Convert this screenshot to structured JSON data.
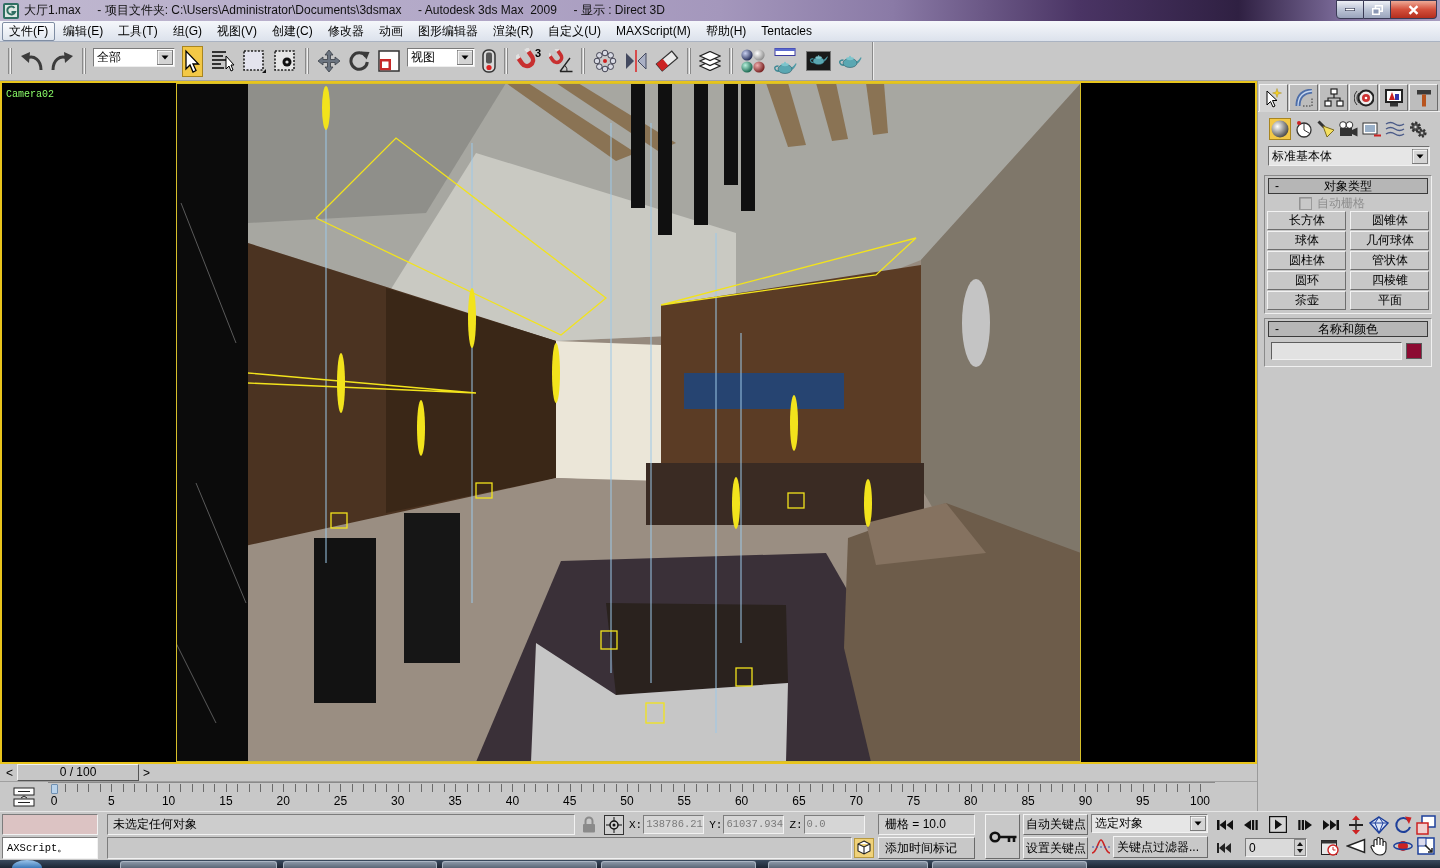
{
  "window": {
    "title": "大厅1.max     - 项目文件夹: C:\\Users\\Administrator\\Documents\\3dsmax     - Autodesk 3ds Max  2009     - 显示 : Direct 3D"
  },
  "menu": [
    {
      "label": "文件(F)",
      "selected": true
    },
    {
      "label": "编辑(E)",
      "selected": false
    },
    {
      "label": "工具(T)",
      "selected": false
    },
    {
      "label": "组(G)",
      "selected": false
    },
    {
      "label": "视图(V)",
      "selected": false
    },
    {
      "label": "创建(C)",
      "selected": false
    },
    {
      "label": "修改器",
      "selected": false
    },
    {
      "label": "动画",
      "selected": false
    },
    {
      "label": "图形编辑器",
      "selected": false
    },
    {
      "label": "渲染(R)",
      "selected": false
    },
    {
      "label": "自定义(U)",
      "selected": false
    },
    {
      "label": "MAXScript(M)",
      "selected": false
    },
    {
      "label": "帮助(H)",
      "selected": false
    },
    {
      "label": "Tentacles",
      "selected": false
    }
  ],
  "toolbar": {
    "selection_filter": "全部",
    "coordinate_system": "视图",
    "snap_dimension": "3",
    "mode_tools": [
      {
        "selected": true
      },
      {
        "selected": false
      },
      {
        "selected": false
      },
      {
        "selected": false
      }
    ]
  },
  "viewport": {
    "label": "Camera02",
    "active": true
  },
  "command_panel": {
    "tabs": [
      {
        "selected": true
      },
      {
        "selected": false
      },
      {
        "selected": false
      },
      {
        "selected": false
      },
      {
        "selected": false
      },
      {
        "selected": false
      }
    ],
    "categories": [
      {
        "selected": true
      },
      {
        "selected": false
      },
      {
        "selected": false
      },
      {
        "selected": false
      },
      {
        "selected": false
      },
      {
        "selected": false
      },
      {
        "selected": false
      }
    ],
    "object_category": "标准基本体",
    "rollouts": [
      {
        "kind": "object_type",
        "marker": "-",
        "title": "对象类型",
        "autogrid": {
          "label": "自动栅格",
          "checked": false,
          "disabled": true
        },
        "buttons": [
          "长方体",
          "圆锥体",
          "球体",
          "几何球体",
          "圆柱体",
          "管状体",
          "圆环",
          "四棱锥",
          "茶壶",
          "平面"
        ]
      },
      {
        "kind": "name_color",
        "marker": "-",
        "title": "名称和颜色",
        "color": "#8c0a32"
      }
    ]
  },
  "time_slider": {
    "prev": "<",
    "position": "0 / 100",
    "next": ">",
    "level": 0
  },
  "track_bar": {
    "ticks": [
      "0",
      "5",
      "10",
      "15",
      "20",
      "25",
      "30",
      "35",
      "40",
      "45",
      "50",
      "55",
      "60",
      "65",
      "70",
      "75",
      "80",
      "85",
      "90",
      "95",
      "100"
    ]
  },
  "status_bar": {
    "listener_label": "AXScript。",
    "prompt": "未选定任何对象",
    "selection_locked": false,
    "coordinates": [
      {
        "axis": "X:",
        "value": "138786.21"
      },
      {
        "axis": "Y:",
        "value": "61037.934"
      },
      {
        "axis": "Z:",
        "value": "0.0"
      }
    ],
    "grid": "栅格 = 10.0",
    "time_tag": "添加时间标记",
    "auto_key": {
      "label": "自动关键点",
      "on": false
    },
    "set_key": "设置关键点",
    "key_set": "选定对象",
    "key_filters": "关键点过滤器...",
    "frame": "0"
  }
}
